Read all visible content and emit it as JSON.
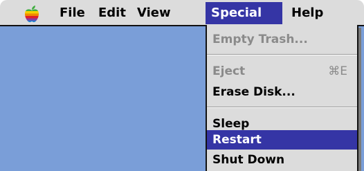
{
  "menubar": {
    "apple_icon": "apple-rainbow-icon",
    "menus": [
      "File",
      "Edit",
      "View",
      "Special",
      "Help"
    ],
    "active_menu": "Special"
  },
  "special_menu": {
    "items": [
      {
        "label": "Empty Trash...",
        "enabled": false
      },
      {
        "label": "Eject",
        "shortcut": "⌘E",
        "enabled": false
      },
      {
        "label": "Erase Disk...",
        "enabled": true
      },
      {
        "label": "Sleep",
        "enabled": true
      },
      {
        "label": "Restart",
        "enabled": true,
        "highlighted": true
      },
      {
        "label": "Shut Down",
        "enabled": true
      }
    ]
  },
  "colors": {
    "menubar": "#dcdcdc",
    "highlight": "#3535a5",
    "desktop": "#7a9ed8",
    "disabled_text": "#8a8a8a"
  }
}
